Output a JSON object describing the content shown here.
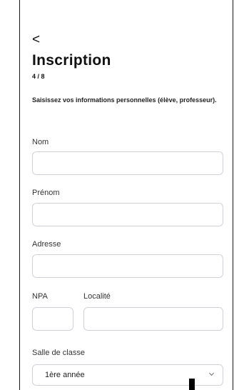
{
  "header": {
    "back_icon": "chevron-left-icon",
    "back_glyph": "<",
    "title": "Inscription",
    "step": "4 / 8",
    "description": "Saisissez vos informations personnelles (élève, professeur)."
  },
  "form": {
    "nom": {
      "label": "Nom",
      "value": ""
    },
    "prenom": {
      "label": "Prénom",
      "value": ""
    },
    "adresse": {
      "label": "Adresse",
      "value": ""
    },
    "npa": {
      "label": "NPA",
      "value": ""
    },
    "localite": {
      "label": "Localité",
      "value": ""
    },
    "salle": {
      "label": "Salle de classe",
      "selected": "1ère année",
      "icon": "chevron-down-icon"
    }
  },
  "colors": {
    "border": "#cfd3d8",
    "text": "#111111",
    "background": "#ffffff"
  }
}
